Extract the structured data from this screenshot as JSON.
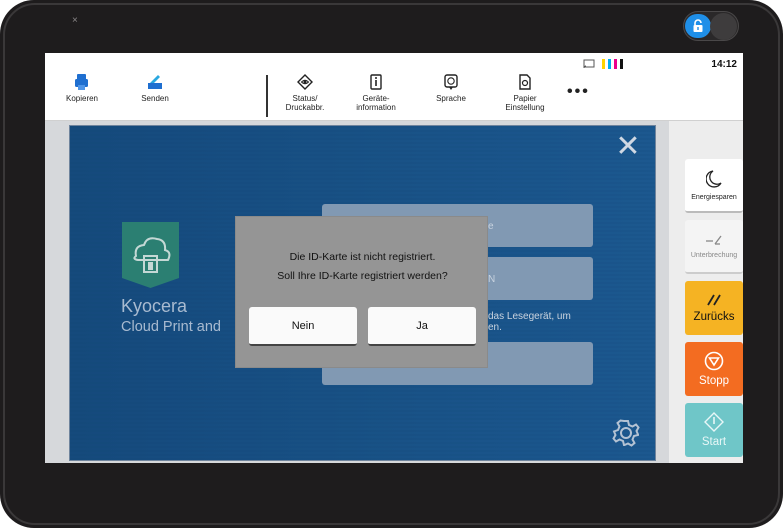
{
  "device": {
    "pin_glyph": "×"
  },
  "toolbar": {
    "kopieren": "Kopieren",
    "senden": "Senden",
    "status_1": "Status/",
    "status_2": "Druckabbr.",
    "geraete_1": "Geräte-",
    "geraete_2": "information",
    "sprache": "Sprache",
    "papier_1": "Papier",
    "papier_2": "Einstellung",
    "more": "•••",
    "clock": "14:12"
  },
  "app": {
    "brand_name": "Kyocera",
    "brand_sub": "Cloud Print and",
    "bg_field1_text": "e",
    "bg_field2_text": "N",
    "bg_hint_1": "das Lesegerät, um",
    "bg_hint_2": "en.",
    "close_glyph": "✕"
  },
  "dialog": {
    "line1": "Die ID-Karte ist nicht registriert.",
    "line2": "Soll Ihre ID-Karte registriert werden?",
    "no_label": "Nein",
    "yes_label": "Ja"
  },
  "side": {
    "energie": "Energiesparen",
    "unterbrechung": "Unterbrechung",
    "zurueck": "Zurücks",
    "stopp": "Stopp",
    "start": "Start"
  },
  "colors": {
    "toner_cyan": "#00aeef",
    "toner_magenta": "#ec008c",
    "toner_yellow": "#ffd400",
    "toner_black": "#111111",
    "zurueck_bg": "#f5b323",
    "stopp_bg": "#f36c21",
    "start_bg": "#6fc6c8",
    "lock_blue": "#1f8fe8"
  }
}
